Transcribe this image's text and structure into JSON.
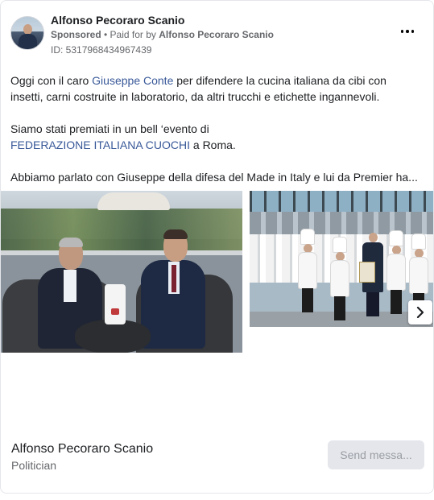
{
  "post": {
    "page_name": "Alfonso Pecoraro Scanio",
    "sponsored_label": "Sponsored",
    "separator": " • ",
    "paid_for_prefix": "Paid for by ",
    "paid_for_by": "Alfonso Pecoraro Scanio",
    "ad_id": "ID: 5317968434967439",
    "more_icon": "more-horizontal-icon"
  },
  "body": {
    "p1_before": "Oggi con il caro ",
    "p1_link": "Giuseppe Conte",
    "p1_after": " per difendere la cucina italiana da cibi con insetti, carni costruite in laboratorio, da altri trucchi e etichette ingannevoli.",
    "p2_before": "Siamo stati premiati in un bell ‘evento di ",
    "p2_link": "FEDERAZIONE ITALIANA CUOCHI",
    "p2_after": " a Roma.",
    "p3": "Abbiamo parlato con Giuseppe della difesa del Made in Italy e lui da Premier ha..."
  },
  "carousel": {
    "next_icon": "chevron-right-icon"
  },
  "footer": {
    "name": "Alfonso Pecoraro Scanio",
    "category": "Politician",
    "cta_label": "Send messa..."
  },
  "colors": {
    "link": "#385898",
    "secondary_text": "#65676b",
    "button_bg": "#e4e6eb"
  }
}
